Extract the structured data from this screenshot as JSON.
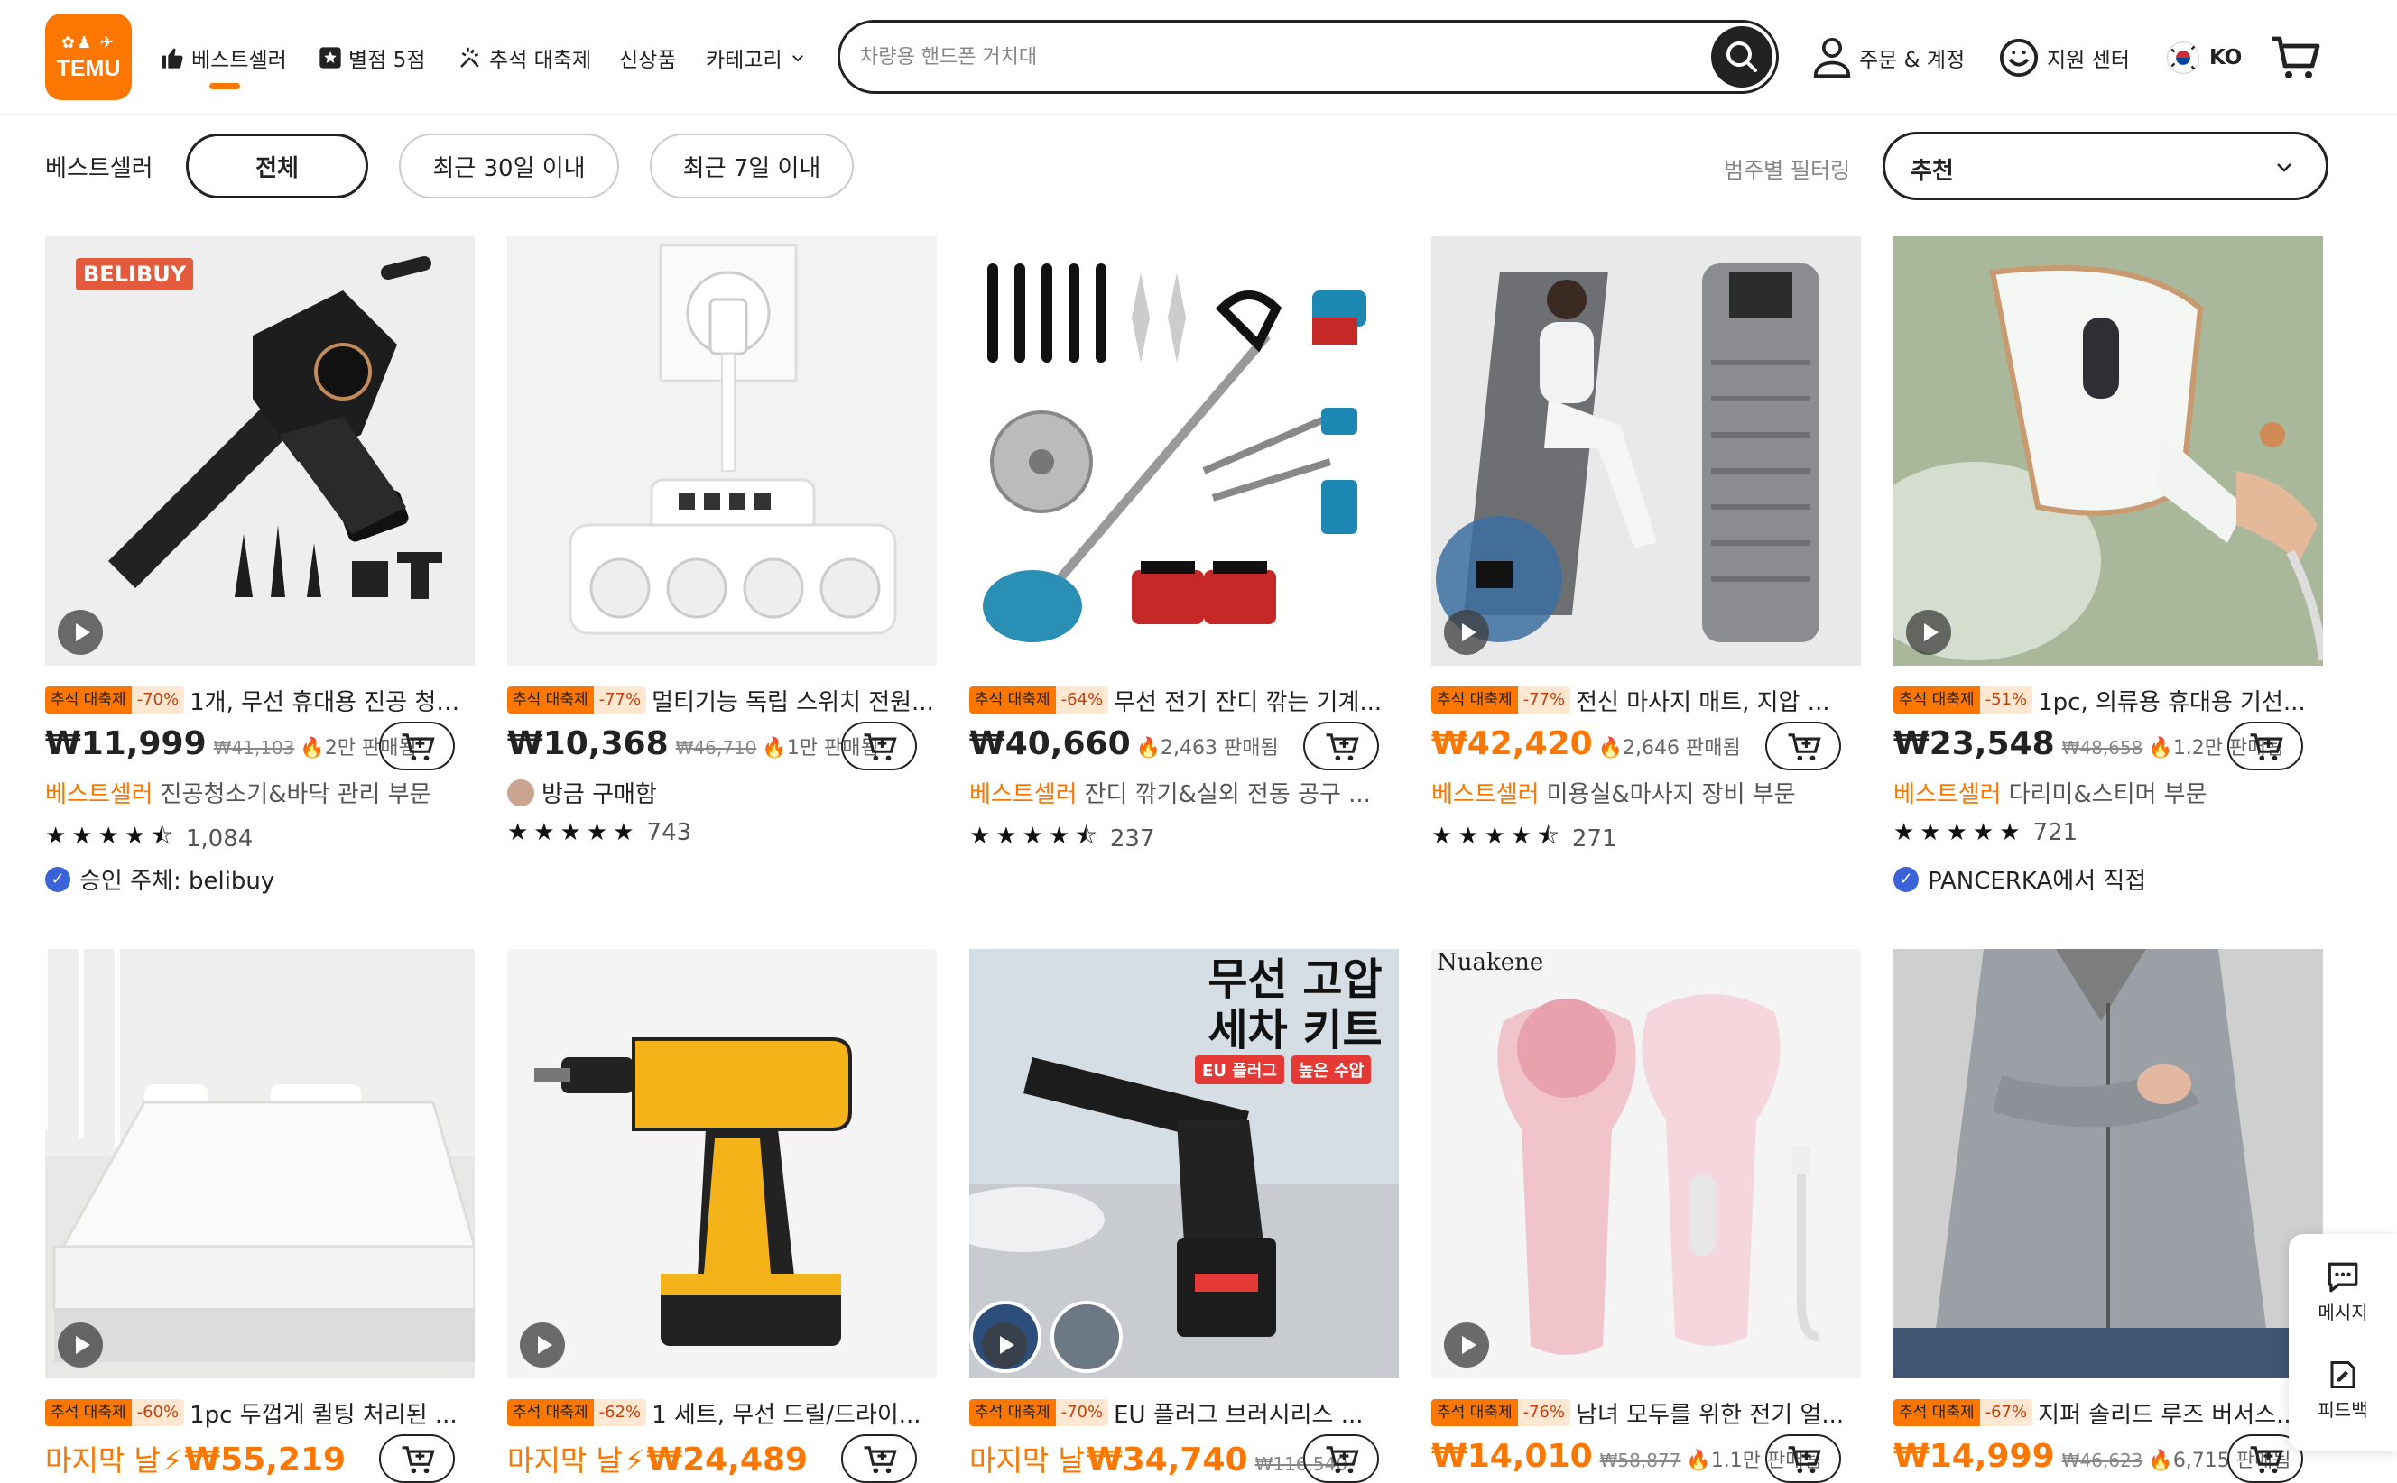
{
  "header": {
    "logo_text": "TEMU",
    "nav": [
      {
        "label": "베스트셀러",
        "icon": "thumbs-up-icon"
      },
      {
        "label": "별점 5점",
        "icon": "star-icon"
      },
      {
        "label": "추석 대축제",
        "icon": "sparkle-icon"
      },
      {
        "label": "신상품"
      },
      {
        "label": "카테고리",
        "icon": "chevron-down-icon"
      }
    ],
    "search_placeholder": "차량용 핸드폰 거치대",
    "account_label": "주문 & 계정",
    "support_label": "지원 센터",
    "lang_label": "KO"
  },
  "filters": {
    "label": "베스트셀러",
    "pills": [
      "전체",
      "최근 30일 이내",
      "최근 7일 이내"
    ],
    "active_pill": "전체",
    "sort_label": "범주별 필터링",
    "sort_value": "추천"
  },
  "products": [
    {
      "festival": "추석 대축제",
      "discount": "-70%",
      "title": "1개, 무선 휴대용 진공 청소기...",
      "price": "₩11,999",
      "orig": "₩41,103",
      "sold": "2만 판매됨",
      "bestseller": "베스트셀러",
      "category": "진공청소기&바닥 관리 부문",
      "stars": "★★★★⯪",
      "reviews": "1,084",
      "seller": "승인 주체: belibuy",
      "img_badge": "BELIBUY"
    },
    {
      "festival": "추석 대축제",
      "discount": "-77%",
      "title": "멀티기능 독립 스위치 전원...",
      "price": "₩10,368",
      "orig": "₩46,710",
      "sold": "1만 판매됨",
      "bought": "방금 구매함",
      "stars": "★★★★★",
      "reviews": "743"
    },
    {
      "festival": "추석 대축제",
      "discount": "-64%",
      "title": "무선 전기 잔디 깎는 기계...",
      "price": "₩40,660",
      "sold": "2,463 판매됨",
      "bestseller": "베스트셀러",
      "category": "잔디 깎기&실외 전동 공구 ...",
      "stars": "★★★★⯪",
      "reviews": "237"
    },
    {
      "festival": "추석 대축제",
      "discount": "-77%",
      "title": "전신 마사지 매트, 지압 ...",
      "price": "₩42,420",
      "sold": "2,646 판매됨",
      "bestseller": "베스트셀러",
      "category": "미용실&마사지 장비 부문",
      "stars": "★★★★⯪",
      "reviews": "271"
    },
    {
      "festival": "추석 대축제",
      "discount": "-51%",
      "title": "1pc, 의류용 휴대용 기선...",
      "price": "₩23,548",
      "orig": "₩48,658",
      "sold": "1.2만 판매됨",
      "bestseller": "베스트셀러",
      "category": "다리미&스티머 부문",
      "stars": "★★★★★",
      "reviews": "721",
      "seller": "PANCERKA에서 직접"
    },
    {
      "festival": "추석 대축제",
      "discount": "-60%",
      "title": "1pc 두껍게 퀼팅 처리된 ...",
      "lastday": "마지막 날",
      "price": "₩55,219"
    },
    {
      "festival": "추석 대축제",
      "discount": "-62%",
      "title": "1 세트, 무선 드릴/드라이...",
      "lastday": "마지막 날",
      "price": "₩24,489"
    },
    {
      "festival": "추석 대축제",
      "discount": "-70%",
      "title": "EU 플러그 브러시리스 ...",
      "lastday": "마지막 날",
      "price": "₩34,740",
      "orig": "₩116,540",
      "img_text1": "무선 고압",
      "img_text2": "세차 키트",
      "img_tag1": "EU 플러그",
      "img_tag2": "높은 수압"
    },
    {
      "festival": "추석 대축제",
      "discount": "-76%",
      "title": "남녀 모두를 위한 전기 얼...",
      "price": "₩14,010",
      "orig": "₩58,877",
      "sold": "1.1만 판매됨",
      "img_brand": "Nuakene"
    },
    {
      "festival": "추석 대축제",
      "discount": "-67%",
      "title": "지퍼 솔리드 루즈 버서스...",
      "price": "₩14,999",
      "orig": "₩46,623",
      "sold": "6,715 판매됨"
    }
  ],
  "side": {
    "message": "메시지",
    "feedback": "피드백"
  }
}
